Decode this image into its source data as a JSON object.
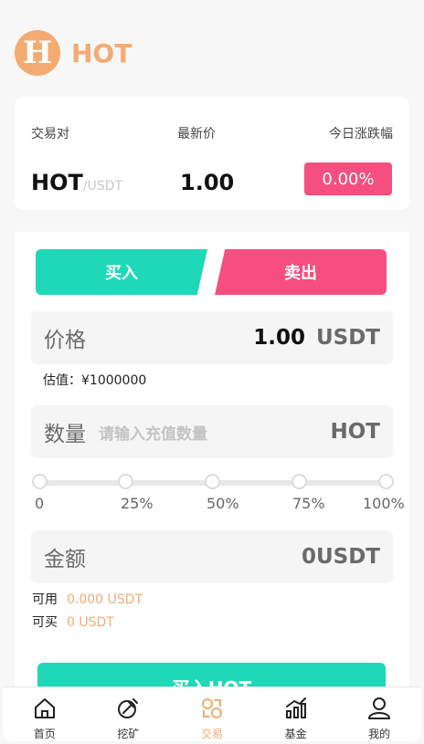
{
  "header": {
    "logo_letter": "H",
    "app_name": "HOT"
  },
  "ticker": {
    "col_pair": "交易对",
    "col_price": "最新价",
    "col_change": "今日涨跌幅",
    "base": "HOT",
    "quote": "/USDT",
    "last_price": "1.00",
    "change": "0.00%"
  },
  "trade": {
    "buy_tab": "买入",
    "sell_tab": "卖出",
    "price_label": "价格",
    "price_value": "1.00",
    "price_unit": "USDT",
    "estimate": "估值：¥1000000",
    "qty_label": "数量",
    "qty_placeholder": "请输入充值数量",
    "qty_unit": "HOT",
    "slider": {
      "ticks": [
        "0",
        "25%",
        "50%",
        "75%",
        "100%"
      ],
      "value_percent": 0
    },
    "amount_label": "金额",
    "amount_value": "0USDT",
    "available_label": "可用",
    "available_value": "0.000 USDT",
    "can_buy_label": "可买",
    "can_buy_value": "0 USDT",
    "submit": "买入HOT"
  },
  "tabbar": {
    "items": [
      {
        "label": "首页",
        "icon": "home-icon"
      },
      {
        "label": "挖矿",
        "icon": "mining-icon"
      },
      {
        "label": "交易",
        "icon": "trade-icon"
      },
      {
        "label": "基金",
        "icon": "fund-chart-icon"
      },
      {
        "label": "我的",
        "icon": "user-icon"
      }
    ],
    "active_index": 2
  },
  "colors": {
    "accent": "#f4ab72",
    "buy": "#1ed8b8",
    "sell": "#f44f7e"
  }
}
